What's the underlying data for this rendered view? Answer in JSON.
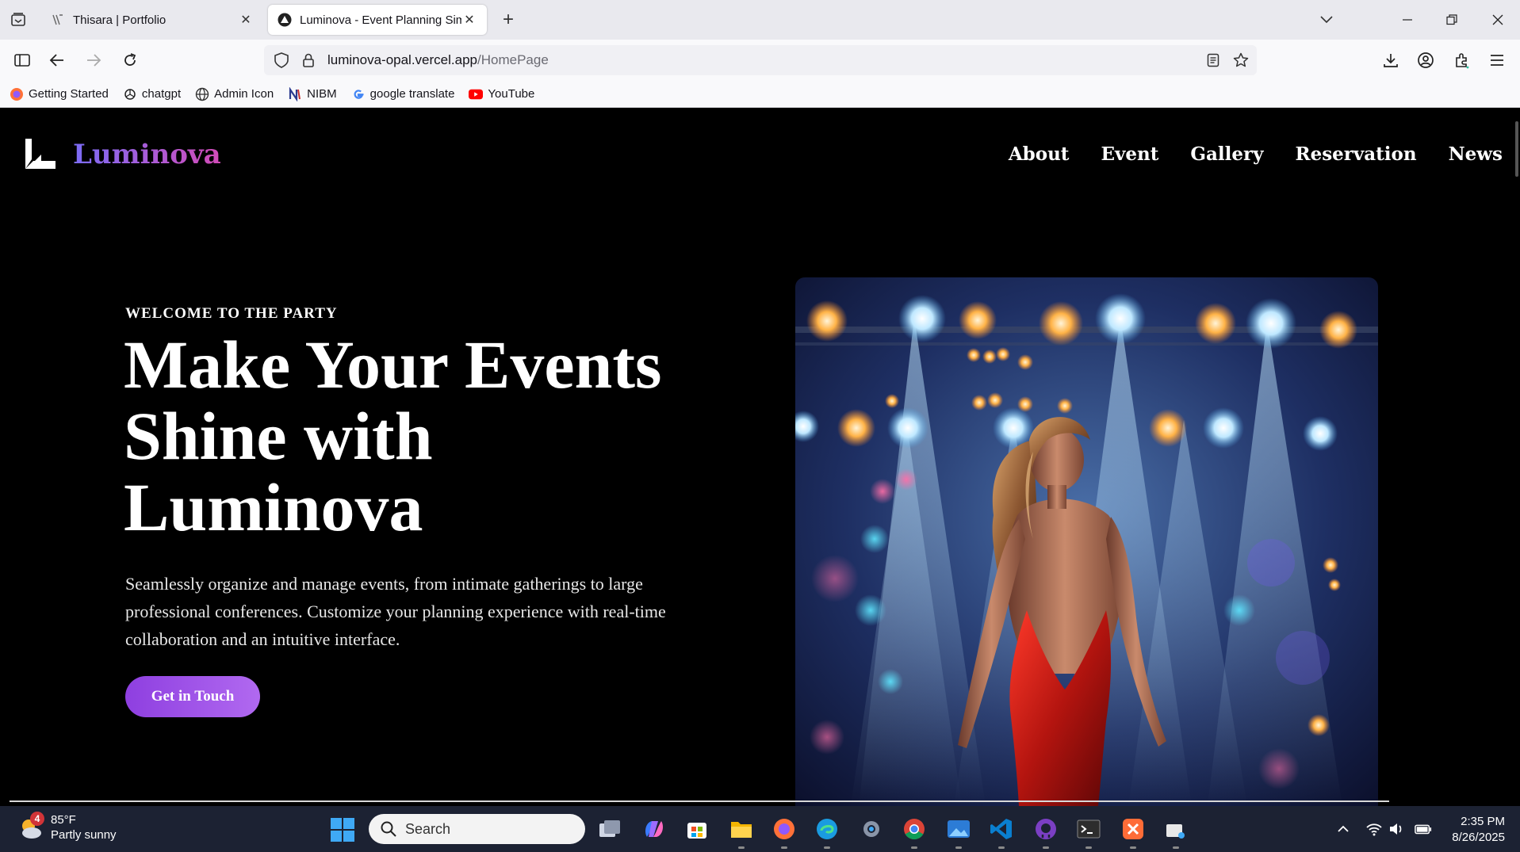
{
  "browser": {
    "tabs": [
      {
        "title": "Thisara | Portfolio",
        "active": false
      },
      {
        "title": "Luminova - Event Planning Simplified",
        "active": true
      }
    ],
    "url_host": "luminova-opal.vercel.app",
    "url_path": "/HomePage",
    "bookmarks": [
      {
        "label": "Getting Started",
        "icon": "firefox-icon"
      },
      {
        "label": "chatgpt",
        "icon": "openai-icon"
      },
      {
        "label": "Admin Icon",
        "icon": "globe-icon"
      },
      {
        "label": "NIBM",
        "icon": "nibm-icon"
      },
      {
        "label": "google translate",
        "icon": "google-icon"
      },
      {
        "label": "YouTube",
        "icon": "youtube-icon"
      }
    ]
  },
  "site": {
    "brand": "Luminova",
    "nav": [
      "About",
      "Event",
      "Gallery",
      "Reservation",
      "News"
    ],
    "eyebrow": "WELCOME TO THE PARTY",
    "headline_lines": [
      "Make Your Events",
      "Shine with",
      "Luminova"
    ],
    "lead": "Seamlessly organize and manage events, from intimate gatherings to large professional conferences. Customize your planning experience with real-time collaboration and an intuitive interface.",
    "cta": "Get in Touch",
    "brand_gradient": [
      "#7b6cf6",
      "#d34bb8"
    ],
    "cta_gradient": [
      "#8e3fe0",
      "#b169f0"
    ]
  },
  "taskbar": {
    "weather_temp": "85°F",
    "weather_desc": "Partly sunny",
    "weather_badge": "4",
    "search_placeholder": "Search",
    "time": "2:35 PM",
    "date": "8/26/2025"
  }
}
